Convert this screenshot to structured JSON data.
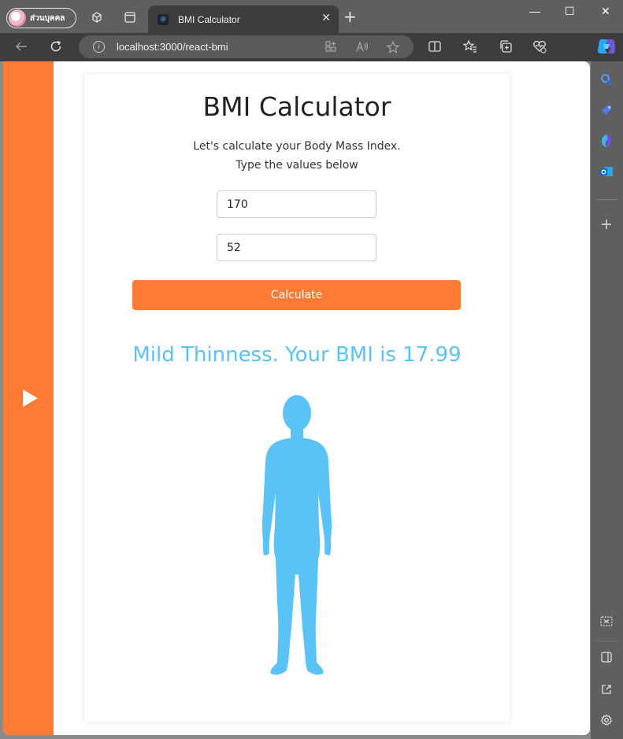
{
  "browser": {
    "profile_label": "ส่วนบุคคล",
    "tab_title": "BMI Calculator",
    "tab_close": "✕",
    "new_tab": "+",
    "window_controls": {
      "minimize": "—",
      "maximize": "☐",
      "close": "✕"
    },
    "address_bar": {
      "url": "localhost:3000/react-bmi",
      "info": "i"
    }
  },
  "app": {
    "title": "BMI Calculator",
    "subtitle_line1": "Let's calculate your Body Mass Index.",
    "subtitle_line2": "Type the values below",
    "height_value": "170",
    "weight_value": "52",
    "calculate_label": "Calculate",
    "result_text": "Mild Thinness. Your BMI is 17.99"
  },
  "colors": {
    "accent": "#ff7b35",
    "result": "#5bc2f5",
    "figure": "#5bc2f5"
  },
  "icons": [
    "profile-avatar-icon",
    "workspaces-icon",
    "tab-actions-icon",
    "react-favicon-icon",
    "back-icon",
    "refresh-icon",
    "info-icon",
    "app-available-icon",
    "read-aloud-icon",
    "favorite-star-icon",
    "split-screen-icon",
    "favorites-icon",
    "collections-icon",
    "browser-essentials-icon",
    "copilot-icon",
    "search-icon",
    "shopping-tag-icon",
    "games-icon",
    "outlook-icon",
    "add-icon",
    "screenshot-icon",
    "sidebar-toggle-icon",
    "open-external-icon",
    "settings-gear-icon",
    "play-icon",
    "human-figure-icon"
  ]
}
